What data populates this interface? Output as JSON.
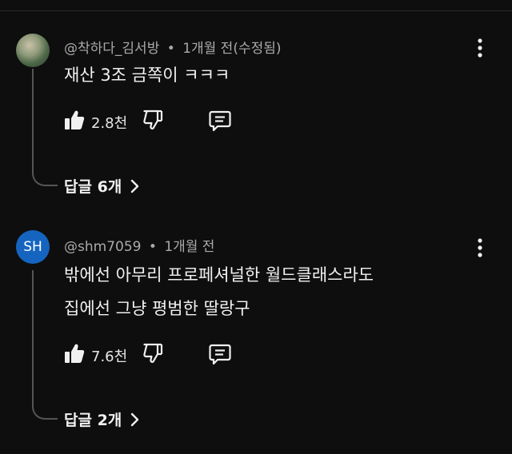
{
  "comments": [
    {
      "author": "@착하다_김서방",
      "separator": "•",
      "time": "1개월 전(수정됨)",
      "avatar_type": "photo",
      "lines": [
        "재산 3조 금쪽이 ㅋㅋㅋ"
      ],
      "likes": "2.8천",
      "replies_label": "답글 6개"
    },
    {
      "author": "@shm7059",
      "separator": "•",
      "time": "1개월 전",
      "avatar_type": "initials",
      "avatar_initials": "SH",
      "avatar_color": "#1565c0",
      "lines": [
        "밖에선 아무리 프로페셔널한 월드클래스라도",
        "집에선 그냥 평범한 딸랑구"
      ],
      "likes": "7.6천",
      "replies_label": "답글 2개"
    }
  ],
  "icons": {
    "like": "thumbs-up-icon",
    "dislike": "thumbs-down-icon",
    "reply": "reply-comment-icon",
    "menu": "more-vertical-icon",
    "chevron": "chevron-right-icon"
  },
  "colors": {
    "background": "#0e0e0e",
    "text": "#f1f1f1",
    "secondary_text": "#aaaaaa",
    "avatar_sh": "#1565c0"
  }
}
